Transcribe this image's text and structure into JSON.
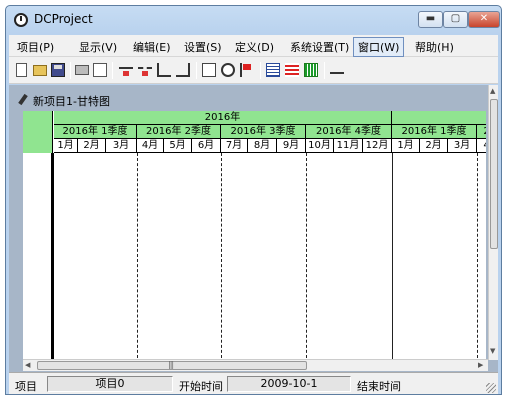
{
  "window": {
    "title": "DCProject"
  },
  "window_buttons": {
    "minimize": "▬",
    "maximize": "▢",
    "close": "✕"
  },
  "menubar": {
    "items": [
      "项目(P)",
      "显示(V)",
      "编辑(E)",
      "设置(S)",
      "定义(D)",
      "系统设置(T)",
      "窗口(W)",
      "帮助(H)"
    ],
    "active": "窗口(W)"
  },
  "toolbar": {
    "icons": [
      "new-icon",
      "open-icon",
      "save-icon",
      "print-icon",
      "preview-icon",
      "link-icon",
      "unlink-icon",
      "indent-icon",
      "outdent-icon",
      "calendar-icon",
      "clock-icon",
      "milestone-icon",
      "grid-icon",
      "bars-icon",
      "progress-icon",
      "sort-icon"
    ]
  },
  "document": {
    "title": "新项目1-甘特图"
  },
  "gantt": {
    "years": [
      "2016年",
      ""
    ],
    "quarters": [
      "2016年 1季度",
      "2016年 2季度",
      "2016年 3季度",
      "2016年 4季度",
      "2016年 1季度",
      "2"
    ],
    "months": [
      "1月",
      "2月",
      "3月",
      "4月",
      "5月",
      "6月",
      "7月",
      "8月",
      "9月",
      "10月",
      "11月",
      "12月",
      "1月",
      "2月",
      "3月",
      "4"
    ]
  },
  "statusbar": {
    "project_label": "项目",
    "project_value": "项目0",
    "start_label": "开始时间",
    "start_value": "2009-10-1",
    "end_label": "结束时间"
  },
  "colors": {
    "header_green": "#90e490",
    "mdi_background": "#a7b6c8",
    "titlebar": "#b9d2ee"
  }
}
